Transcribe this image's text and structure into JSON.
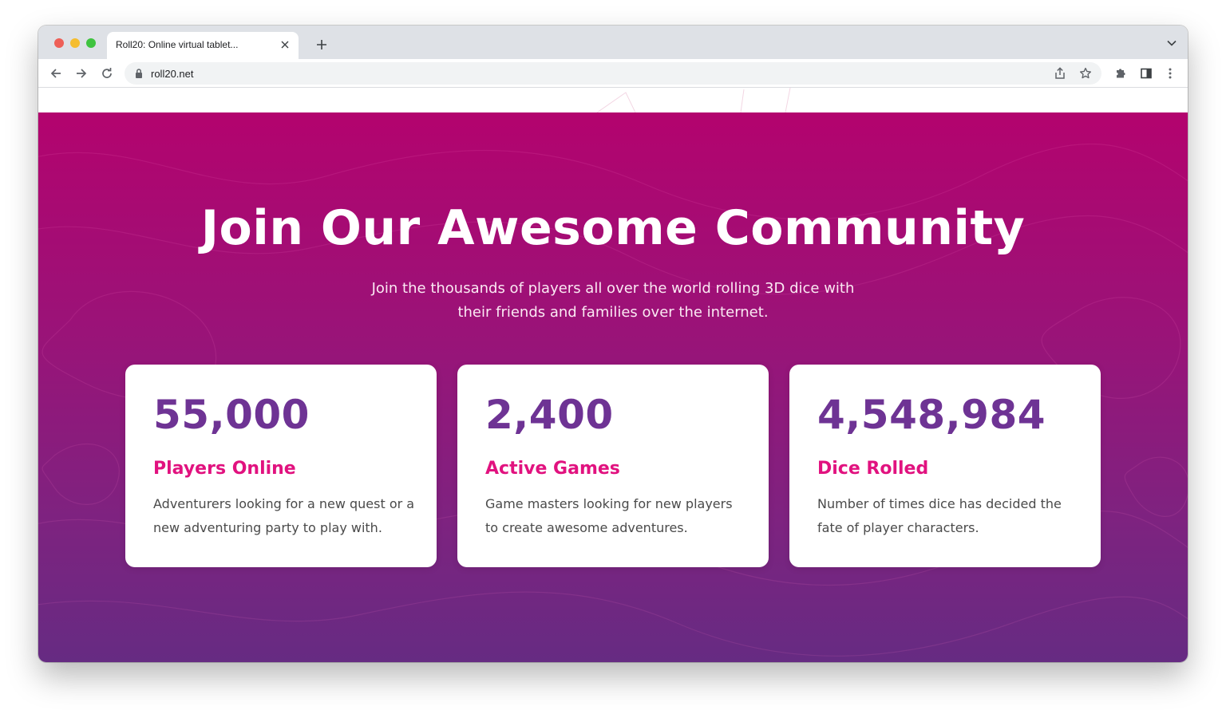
{
  "browser": {
    "tab_title": "Roll20: Online virtual tablet...",
    "url": "roll20.net",
    "icons": {
      "close_tab": "close-icon",
      "new_tab": "plus-icon",
      "tab_search": "chevron-down-icon",
      "back": "arrow-left-icon",
      "forward": "arrow-right-icon",
      "reload": "reload-icon",
      "lock": "lock-icon",
      "share": "share-icon",
      "bookmark": "star-icon",
      "extensions": "puzzle-icon",
      "side_panel": "side-panel-icon",
      "menu": "kebab-menu-icon"
    }
  },
  "hero": {
    "title": "Join Our Awesome Community",
    "subtitle": "Join the thousands of players all over the world rolling 3D dice with their friends and families over the internet.",
    "colors": {
      "gradient_top": "#b3036e",
      "gradient_bottom": "#662b82",
      "number": "#6e3394",
      "label": "#e1127f"
    }
  },
  "stats": [
    {
      "number": "55,000",
      "label": "Players Online",
      "description": "Adventurers looking for a new quest or a new adventuring party to play with."
    },
    {
      "number": "2,400",
      "label": "Active Games",
      "description": "Game masters looking for new players to create awesome adventures."
    },
    {
      "number": "4,548,984",
      "label": "Dice Rolled",
      "description": "Number of times dice has decided the fate of player characters."
    }
  ]
}
